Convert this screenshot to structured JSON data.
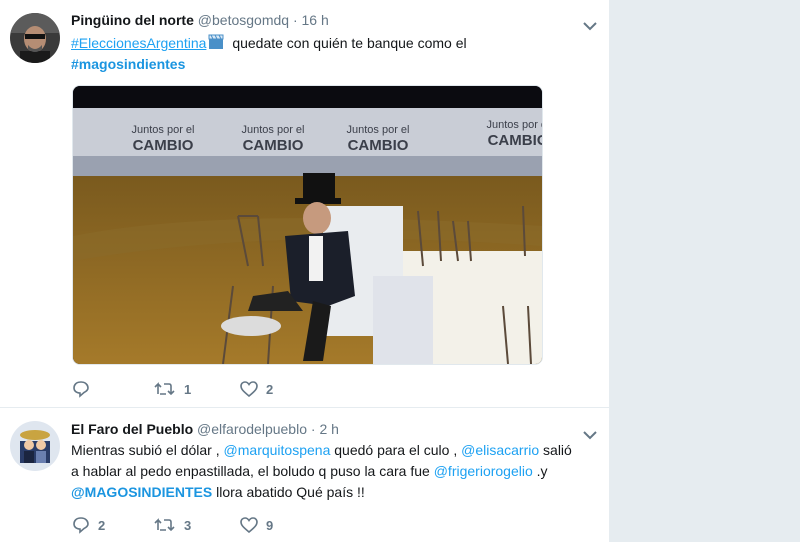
{
  "tweets": [
    {
      "name": "Pingüino del norte",
      "handle": "@betosgomdq",
      "separator": "·",
      "time": "16 h",
      "hashtag": "#EleccionesArgentina",
      "text_after_hashtag": "quedate con quién te banque como el",
      "hashtag2": "#magosindientes",
      "media_banner_text": "Juntos por el",
      "media_banner_brand": "CAMBIO",
      "replies": "",
      "retweets": "1",
      "likes": "2"
    },
    {
      "name": "El Faro del Pueblo",
      "handle": "@elfarodelpueblo",
      "separator": "·",
      "time": "2 h",
      "line1_a": "Mientras subió el dólar ,",
      "mention1": "@marquitospena",
      "line1_b": "quedó para el culo ,",
      "mention2": "@elisacarrio",
      "line1_c": "salió",
      "line2_a": "a hablar al pedo enpastillada, el boludo q puso la cara fue",
      "mention3": "@frigeriorogelio",
      "line2_b": ".y",
      "mention4": "@MAGOSINDIENTES",
      "line3_b": "llora abatido  Qué país !!",
      "replies": "2",
      "retweets": "3",
      "likes": "9"
    }
  ],
  "colors": {
    "link": "#1da1f2",
    "muted": "#657786",
    "background": "#e6ecf0"
  }
}
